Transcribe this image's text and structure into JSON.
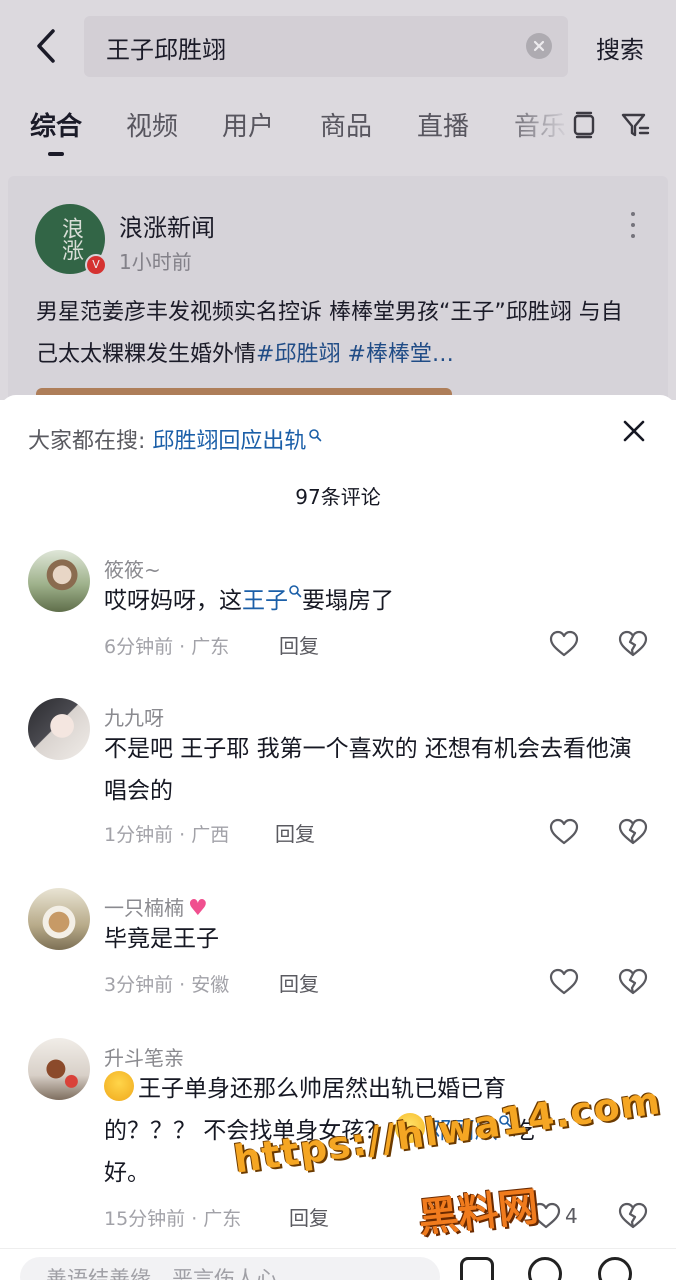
{
  "header": {
    "search_query": "王子邱胜翊",
    "search_button": "搜索"
  },
  "tabs": [
    "综合",
    "视频",
    "用户",
    "商品",
    "直播",
    "音乐"
  ],
  "active_tab": "综合",
  "result_card": {
    "author": "浪涨新闻",
    "avatar_text": "浪涨",
    "time": "1小时前",
    "text": "男星范姜彦丰发视频实名控诉 棒棒堂男孩“王子”邱胜翊 与自己太太粿粿发生婚外情",
    "tags": "#邱胜翊 #棒棒堂…"
  },
  "comments_sheet": {
    "hot_search_label": "大家都在搜:",
    "hot_search_link": "邱胜翊回应出轨",
    "comment_count": "97条评论",
    "reply_label": "回复",
    "comments": [
      {
        "user": "筱筱~",
        "text_before": "哎呀妈呀，这",
        "keyword": "王子",
        "text_after": "要塌房了",
        "meta": "6分钟前 · 广东",
        "likes": ""
      },
      {
        "user": "九九呀",
        "text": "不是吧  王子耶  我第一个喜欢的  还想有机会去看他演唱会的",
        "meta": "1分钟前 · 广西",
        "likes": ""
      },
      {
        "user": "一只楠楠",
        "text": "毕竟是王子",
        "meta": "3分钟前 · 安徽",
        "likes": ""
      },
      {
        "user": "升斗笔亲",
        "text_line1": "王子单身还那么帅居然出轨已婚已育",
        "text_line2_before": "的？？？ 不会找单身女孩？",
        "keyword": "邓丽欣",
        "text_line2_after": "吃",
        "text_line3": "好。",
        "meta": "15分钟前 · 广东",
        "likes": "4"
      }
    ]
  },
  "bottom_bar": {
    "input_placeholder": "善语结善缘，恶言伤人心"
  },
  "watermark": {
    "url": "https://hlwa14.com",
    "name": "黑料网"
  },
  "colors": {
    "link": "#1b5fa8",
    "secondary_text": "#8a8a8f",
    "watermark": "#f5a623"
  }
}
